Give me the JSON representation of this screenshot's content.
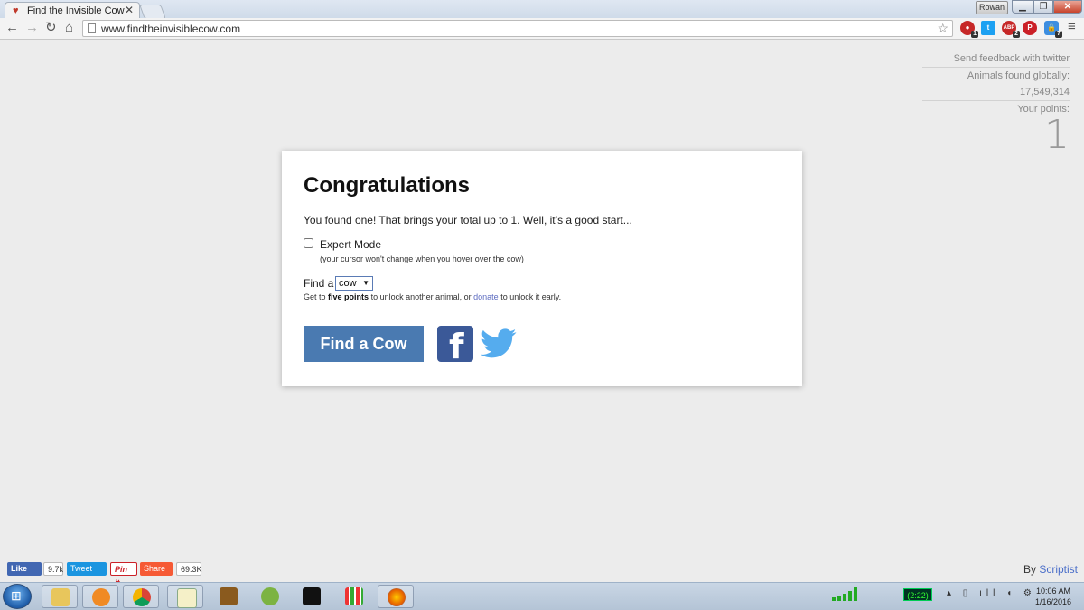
{
  "browser": {
    "tab_title": "Find the Invisible Cow",
    "tab_close": "✕",
    "user": "Rowan",
    "url": "www.findtheinvisiblecow.com",
    "extensions": [
      {
        "name": "hangouts-icon",
        "badge": "1"
      },
      {
        "name": "twitter-extension-icon",
        "badge": ""
      },
      {
        "name": "adblock-icon",
        "label": "ABP",
        "badge": "2"
      },
      {
        "name": "pinterest-extension-icon",
        "badge": ""
      },
      {
        "name": "lastpass-icon",
        "badge": "7"
      }
    ]
  },
  "sidebar": {
    "feedback": "Send feedback with twitter",
    "animals_found": "Animals found globally: 17,549,314",
    "points_label": "Your points:",
    "points_value": "1"
  },
  "dialog": {
    "title": "Congratulations",
    "message": "You found one! That brings your total up to 1. Well, it’s a good start...",
    "expert_label": "Expert Mode",
    "expert_checked": false,
    "expert_note": "(your cursor won't change when you hover over the cow)",
    "find_label": "Find a",
    "animal_selected": "cow",
    "unlock_prefix": "Get to",
    "unlock_bold": "five points",
    "unlock_mid": "to unlock another animal, or",
    "unlock_link": "donate",
    "unlock_suffix": "to unlock it early.",
    "button_label": "Find a Cow"
  },
  "share_bar": {
    "like": "Like",
    "like_count": "9.7k",
    "tweet": "Tweet",
    "pin": "Pin it",
    "share": "Share",
    "share_count": "69.3K"
  },
  "byline": {
    "prefix": "By",
    "link": "Scriptist"
  },
  "taskbar": {
    "battery": "(2:22)",
    "time": "10:06 AM",
    "date": "1/16/2016",
    "apps": [
      "file-explorer-icon",
      "media-player-icon",
      "chrome-icon",
      "notepad-icon",
      "dosbox-icon",
      "hamachi-icon",
      "sonos-icon",
      "apps-grid-icon",
      "firefox-icon"
    ]
  },
  "colors": {
    "primary_button": "#4a7ab1",
    "facebook": "#3b5998",
    "twitter": "#55acee",
    "link": "#5c6bc0"
  }
}
